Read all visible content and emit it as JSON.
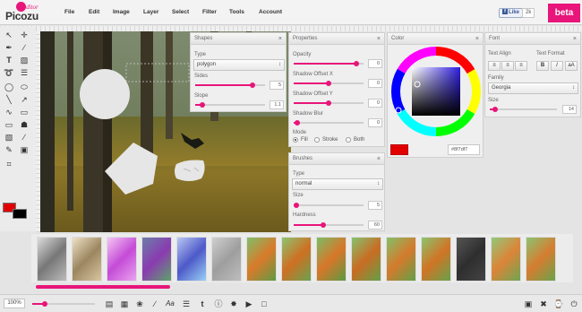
{
  "app": {
    "logo_editor": "editor",
    "logo_name": "Picozu",
    "beta": "beta",
    "facebook_like": "Like",
    "facebook_count": "2k"
  },
  "menu": [
    "File",
    "Edit",
    "Image",
    "Layer",
    "Select",
    "Filter",
    "Tools",
    "Account"
  ],
  "tools": {
    "icons": [
      "pointer-icon",
      "move-icon",
      "pen-icon",
      "brush-icon",
      "text-icon",
      "eraser-icon",
      "lasso-icon",
      "clone-icon",
      "ellipse-icon",
      "fill-icon",
      "line-icon",
      "picker-icon",
      "curve-icon",
      "rect-icon",
      "blur-icon",
      "stamp-icon",
      "gradient-icon",
      "eyedropper-icon",
      "pencil-icon",
      "image-icon",
      "crop-icon"
    ],
    "foreground_color": "#e00000",
    "background_color": "#000000"
  },
  "shapes_panel": {
    "title": "Shapes",
    "type_label": "Type",
    "type_value": "polygon",
    "sides_label": "Sides",
    "sides_value": "5",
    "sides_level": 0.82,
    "slope_label": "Slope",
    "slope_value": "1.1",
    "slope_level": 0.1
  },
  "properties_panel": {
    "title": "Properties",
    "opacity_label": "Opacity",
    "opacity_value": "0",
    "opacity_level": 0.9,
    "shadow_x_label": "Shadow Offset X",
    "shadow_x_value": "0",
    "shadow_x_level": 0.5,
    "shadow_y_label": "Shadow Offset Y",
    "shadow_y_value": "0",
    "shadow_y_level": 0.5,
    "shadow_blur_label": "Shadow Blur",
    "shadow_blur_value": "0",
    "shadow_blur_level": 0.05,
    "mode_label": "Mode",
    "mode_fill": "Fill",
    "mode_stroke": "Stroke",
    "mode_both": "Both",
    "mode_selected": "Fill"
  },
  "brushes_panel": {
    "title": "Brushes",
    "type_label": "Type",
    "type_value": "normal",
    "size_label": "Size",
    "size_value": "5",
    "size_level": 0.04,
    "hardness_label": "Hardness",
    "hardness_value": "60",
    "hardness_level": 0.42
  },
  "color_panel": {
    "title": "Color",
    "hex_value": "#8f7df7",
    "swatch_color": "#e00000",
    "picked_hue_color": "#8f7df7"
  },
  "font_panel": {
    "title": "Font",
    "text_align_label": "Text Align",
    "text_format_label": "Text Format",
    "align_icons": [
      "align-left-icon",
      "align-center-icon",
      "align-right-icon"
    ],
    "bold": "B",
    "italic": "I",
    "font_size_toggle": "aA",
    "family_label": "Family",
    "family_value": "Georgia",
    "size_label": "Size",
    "size_value": "14",
    "size_level": 0.08
  },
  "thumbnails": [
    {
      "name": "grayscale"
    },
    {
      "name": "sepia"
    },
    {
      "name": "pink"
    },
    {
      "name": "purple"
    },
    {
      "name": "blue"
    },
    {
      "name": "emboss"
    },
    {
      "name": "original-1"
    },
    {
      "name": "original-2"
    },
    {
      "name": "original-3"
    },
    {
      "name": "original-4"
    },
    {
      "name": "original-5"
    },
    {
      "name": "original-6"
    },
    {
      "name": "dark"
    },
    {
      "name": "original-7"
    },
    {
      "name": "original-8"
    }
  ],
  "bottom": {
    "zoom_value": "100%",
    "icons": [
      "layers-icon",
      "folder-icon",
      "effects-icon",
      "brush-panel-icon",
      "font-icon",
      "sliders-icon",
      "twitter-icon",
      "info-icon",
      "adjust-icon",
      "play-icon",
      "nav-icon"
    ],
    "right_icons": [
      "screen-icon",
      "tools-icon",
      "history-icon",
      "power-icon"
    ]
  }
}
